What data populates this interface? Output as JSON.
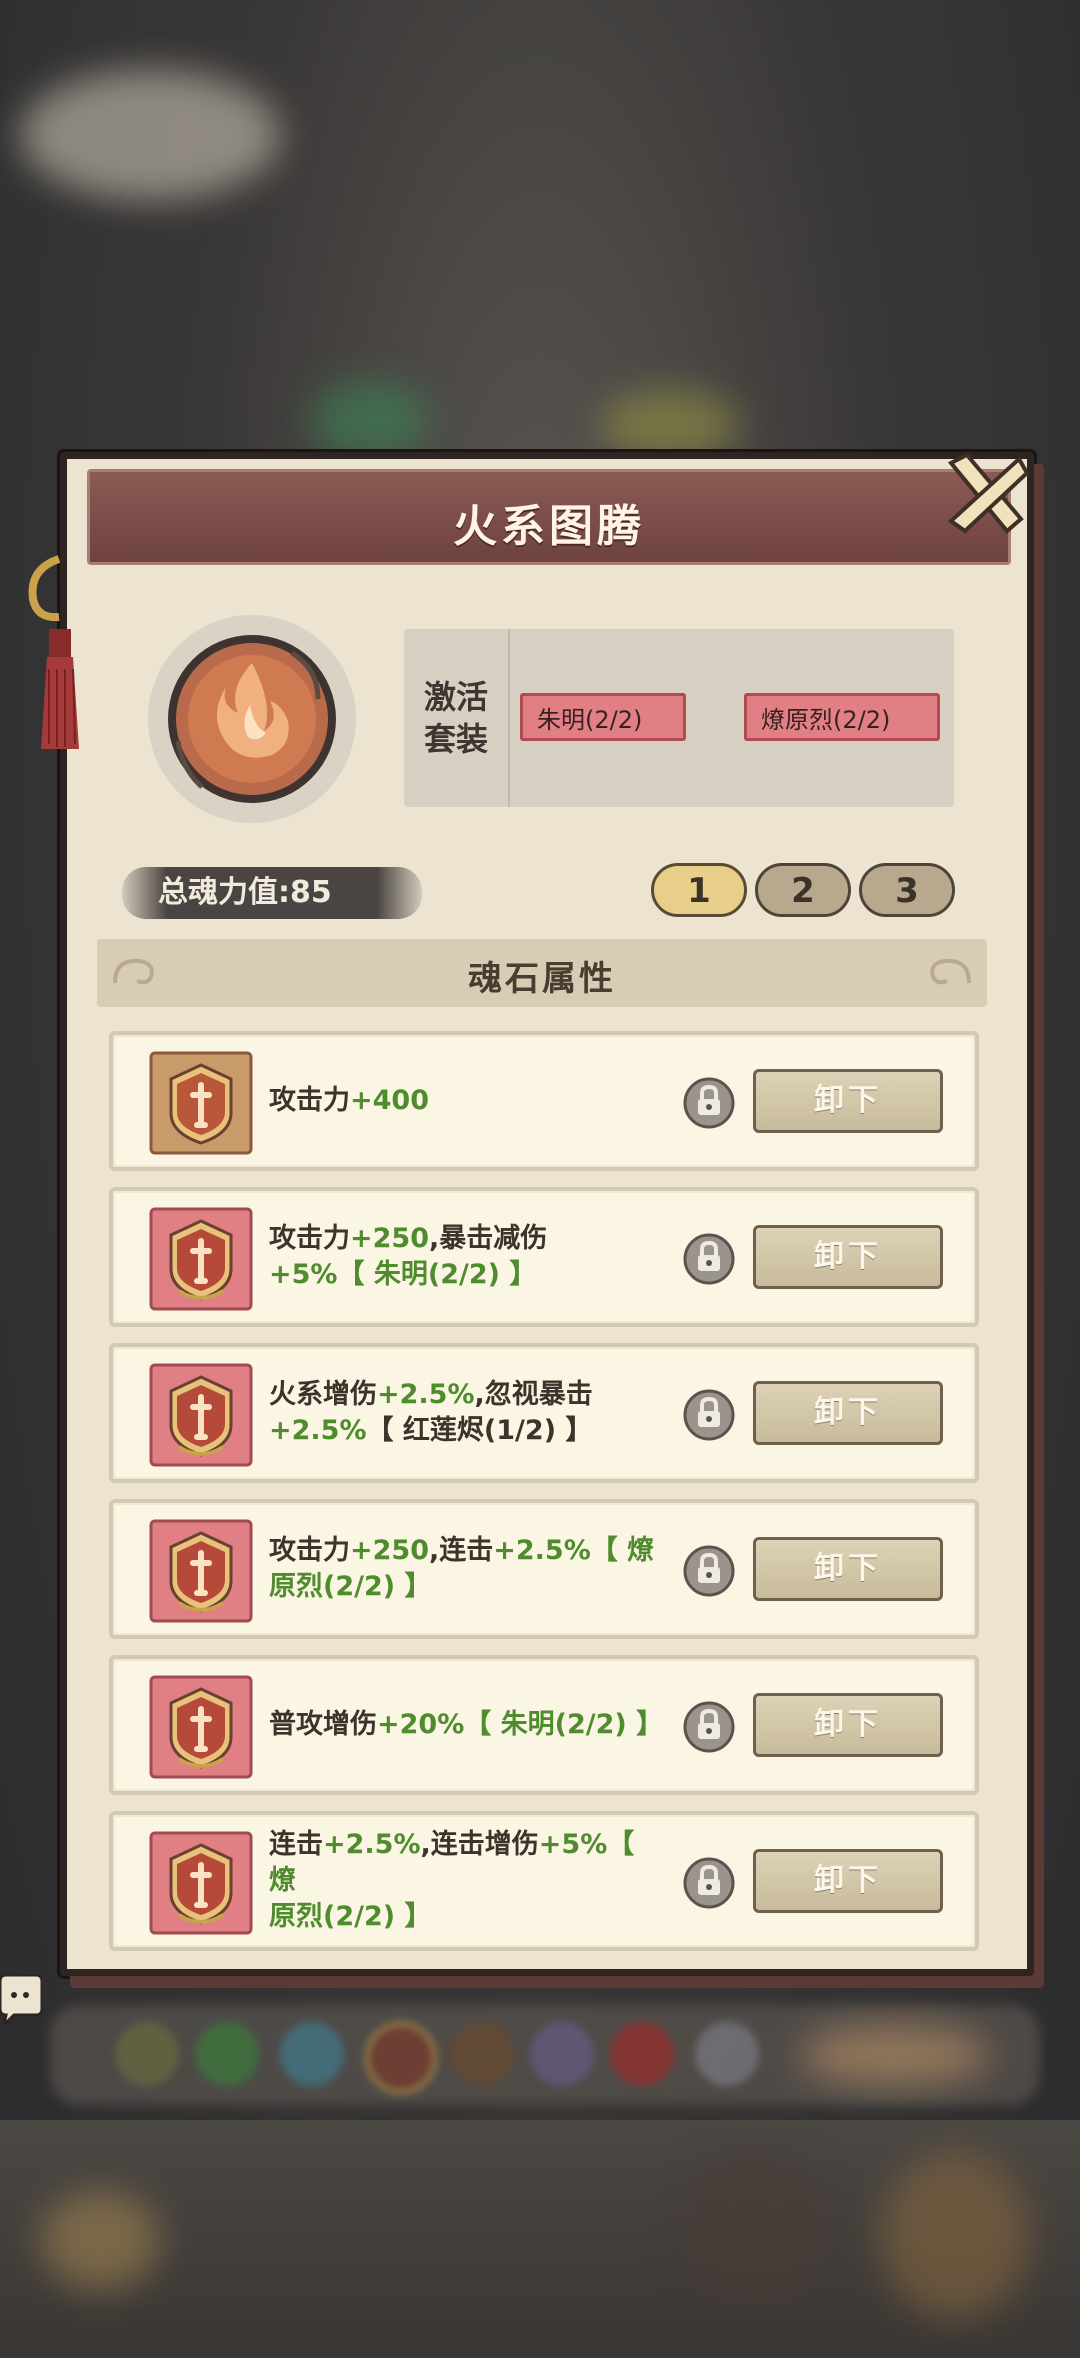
{
  "panel": {
    "title": "火系图腾",
    "active_set_label_line1": "激活",
    "active_set_label_line2": "套装",
    "set_tags": [
      "朱明(2/2)",
      "燎原烈(2/2)"
    ],
    "soul_power": "总魂力值:85",
    "page_tabs": [
      "1",
      "2",
      "3"
    ],
    "active_page": "1",
    "section_title": "魂石属性"
  },
  "stones": [
    {
      "lines": [
        [
          [
            "攻击力",
            ""
          ],
          [
            "+400",
            "g"
          ]
        ]
      ],
      "frame": "bronze",
      "button": "卸下"
    },
    {
      "lines": [
        [
          [
            "攻击力",
            ""
          ],
          [
            "+250",
            "g"
          ],
          [
            ",暴击减伤",
            ""
          ]
        ],
        [
          [
            "+5%",
            "g"
          ],
          [
            "【 朱明(2/2) 】",
            "g"
          ]
        ]
      ],
      "frame": "pink",
      "button": "卸下"
    },
    {
      "lines": [
        [
          [
            "火系增伤",
            ""
          ],
          [
            "+2.5%",
            "g"
          ],
          [
            ",忽视暴击",
            ""
          ]
        ],
        [
          [
            "+2.5%",
            "g"
          ],
          [
            "【 红莲烬(1/2) 】",
            ""
          ]
        ]
      ],
      "frame": "pink",
      "button": "卸下"
    },
    {
      "lines": [
        [
          [
            "攻击力",
            ""
          ],
          [
            "+250",
            "g"
          ],
          [
            ",连击",
            ""
          ],
          [
            "+2.5%",
            "g"
          ],
          [
            "【 燎",
            "g"
          ]
        ],
        [
          [
            "原烈(2/2) 】",
            "g"
          ]
        ]
      ],
      "frame": "pink",
      "button": "卸下"
    },
    {
      "lines": [
        [
          [
            "普攻增伤",
            ""
          ],
          [
            "+20%",
            "g"
          ],
          [
            "【 朱明(2/2) 】",
            "g"
          ]
        ]
      ],
      "frame": "pink",
      "button": "卸下"
    },
    {
      "lines": [
        [
          [
            "连击",
            ""
          ],
          [
            "+2.5%",
            "g"
          ],
          [
            ",连击增伤",
            ""
          ],
          [
            "+5%",
            "g"
          ],
          [
            "【 燎",
            "g"
          ]
        ],
        [
          [
            "原烈(2/2) 】",
            "g"
          ]
        ]
      ],
      "frame": "pink",
      "button": "卸下"
    }
  ],
  "colors": {
    "accent_green": "#4f8c2e",
    "set_tag_pink": "#e07f84",
    "header": "#7a4c47"
  }
}
